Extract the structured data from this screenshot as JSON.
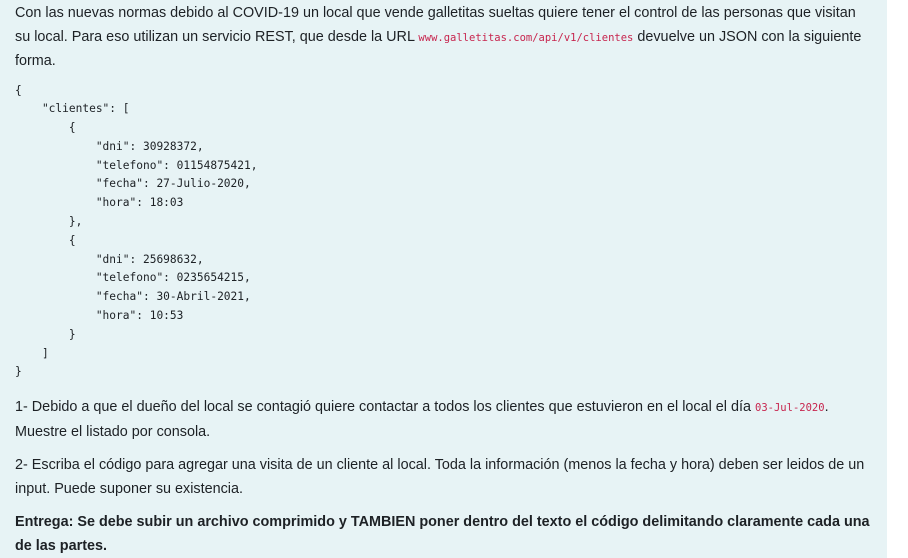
{
  "intro": {
    "before_url": "Con las nuevas normas debido al COVID-19 un local que vende galletitas sueltas quiere tener el control de las personas que visitan su local. Para eso utilizan un servicio REST, que desde la URL ",
    "url": "www.galletitas.com/api/v1/clientes",
    "after_url": " devuelve un JSON con la siguiente forma."
  },
  "code_lines": [
    "{",
    "    \"clientes\": [",
    "        {",
    "            \"dni\": 30928372,",
    "            \"telefono\": 01154875421,",
    "            \"fecha\": 27-Julio-2020,",
    "            \"hora\": 18:03",
    "        },",
    "        {",
    "            \"dni\": 25698632,",
    "            \"telefono\": 0235654215,",
    "            \"fecha\": 30-Abril-2021,",
    "            \"hora\": 10:53",
    "        }",
    "    ]",
    "}"
  ],
  "task1": {
    "before_date": "1- Debido a que el dueño del local se contagió quiere contactar a todos los clientes que estuvieron en el local el día ",
    "date": "03-Jul-2020",
    "after_date": ". Muestre el listado por consola."
  },
  "task2": {
    "text": "2- Escriba el código para agregar una visita de un cliente al local. Toda la información (menos la fecha y hora) deben ser leidos de un input. Puede suponer su existencia."
  },
  "delivery": {
    "text": "Entrega: Se debe subir un archivo comprimido y TAMBIEN poner dentro del texto el código delimitando claramente cada una de las partes."
  }
}
